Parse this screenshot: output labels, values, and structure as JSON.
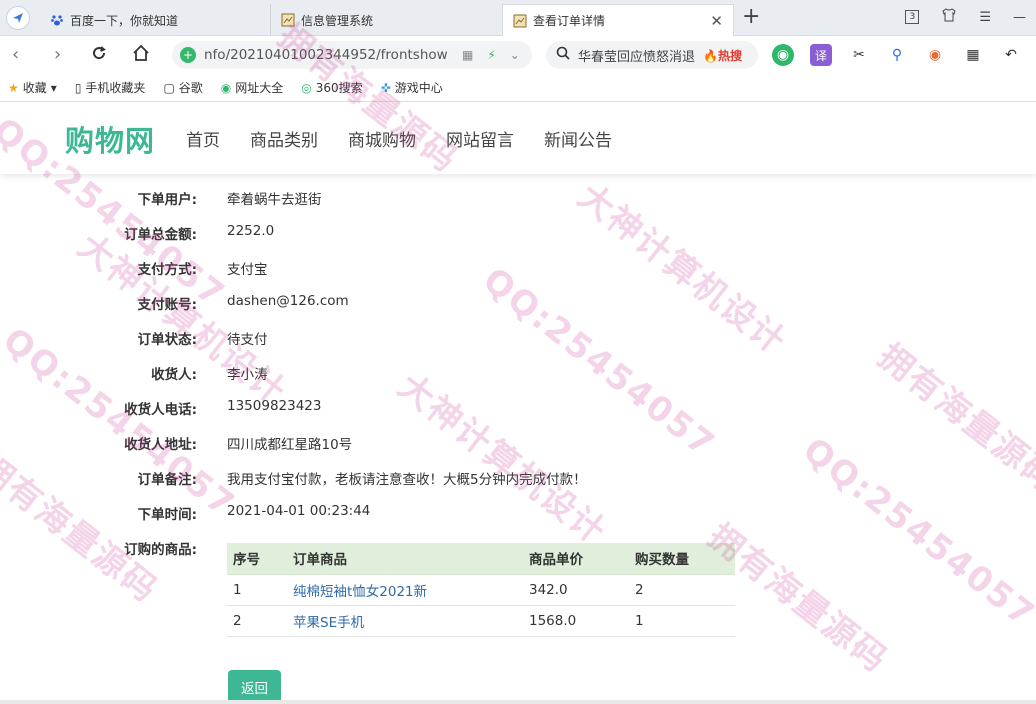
{
  "browser": {
    "tabs": [
      {
        "title": "百度一下，你就知道",
        "icon": "baidu-icon",
        "active": false
      },
      {
        "title": "信息管理系统",
        "icon": "page-icon",
        "active": false
      },
      {
        "title": "查看订单详情",
        "icon": "page-icon",
        "active": true
      }
    ],
    "tab_count": "3",
    "url": "nfo/20210401002344952/frontshow",
    "search_text": "华春莹回应愤怒消退",
    "search_hot": "热搜",
    "translate_label": "译"
  },
  "bookmarks": [
    "收藏",
    "手机收藏夹",
    "谷歌",
    "网址大全",
    "360搜索",
    "游戏中心"
  ],
  "site": {
    "logo": "购物网",
    "nav": [
      "首页",
      "商品类别",
      "商城购物",
      "网站留言",
      "新闻公告"
    ]
  },
  "order": {
    "fields": [
      {
        "label": "下单用户:",
        "value": "牵着蜗牛去逛街"
      },
      {
        "label": "订单总金额:",
        "value": "2252.0"
      },
      {
        "label": "支付方式:",
        "value": "支付宝"
      },
      {
        "label": "支付账号:",
        "value": "dashen@126.com"
      },
      {
        "label": "订单状态:",
        "value": "待支付"
      },
      {
        "label": "收货人:",
        "value": "李小涛"
      },
      {
        "label": "收货人电话:",
        "value": "13509823423"
      },
      {
        "label": "收货人地址:",
        "value": "四川成都红星路10号"
      },
      {
        "label": "订单备注:",
        "value": "我用支付宝付款，老板请注意查收！大概5分钟内完成付款！"
      },
      {
        "label": "下单时间:",
        "value": "2021-04-01 00:23:44"
      }
    ],
    "goods_label": "订购的商品:",
    "goods_headers": [
      "序号",
      "订单商品",
      "商品单价",
      "购买数量"
    ],
    "goods_rows": [
      [
        "1",
        "纯棉短袖t恤女2021新",
        "342.0",
        "2"
      ],
      [
        "2",
        "苹果SE手机",
        "1568.0",
        "1"
      ]
    ],
    "back_label": "返回"
  },
  "watermarks": [
    "QQ:25454057",
    "大神计算机设计",
    "拥有海量源码",
    "QQ:25454057",
    "大神计算机设计",
    "拥有海量源码",
    "QQ:25454057",
    "拥有海量源码",
    "QQ:25454057",
    "大神计算机设计",
    "拥有海量源码"
  ],
  "colors": {
    "brand": "#3eb894",
    "table_head": "#e0efdc",
    "link": "#2e6aa8",
    "watermark": "#c83c96"
  }
}
